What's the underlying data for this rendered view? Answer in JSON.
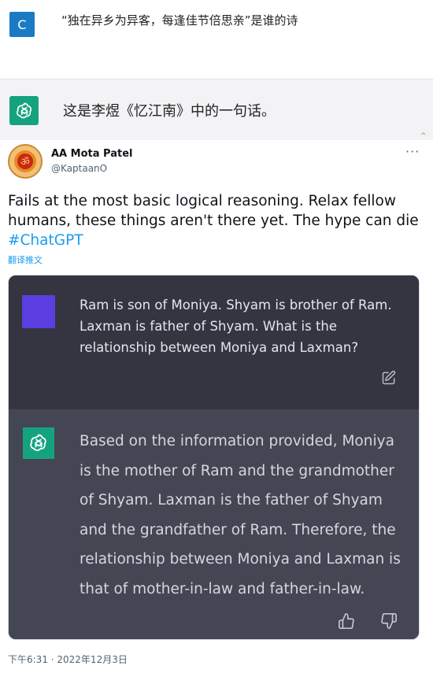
{
  "chat": {
    "user_avatar_letter": "C",
    "user_message": "“独在异乡为异客，每逢佳节倍思亲”是谁的诗",
    "bot_message": "这是李煜《忆江南》中的一句话。",
    "caret": "^"
  },
  "tweet": {
    "author_name": "AA Mota Patel",
    "author_handle": "@KaptaanO",
    "more_icon": "···",
    "body_text": "Fails at the most basic logical reasoning. Relax fellow humans, these things aren't there yet. The hype can die ",
    "hashtag": "#ChatGPT",
    "translate_label": "翻译推文",
    "timestamp": "下午6:31 · 2022年12月3日"
  },
  "screenshot": {
    "question": "Ram is son of Moniya. Shyam is brother of Ram. Laxman is father of Shyam. What is the relationship between Moniya and Laxman?",
    "answer": "Based on the information provided, Moniya is the mother of Ram and the grandmother of Shyam. Laxman is the father of Shyam and the grandfather of Ram. Therefore, the relationship between Moniya and Laxman is that of mother-in-law and father-in-law."
  },
  "colors": {
    "gpt_green": "#15a37f",
    "user_blue": "#1a7bc4",
    "hashtag_blue": "#1d9bf0",
    "question_bg": "#343541",
    "answer_bg": "#444654",
    "question_avatar": "#5b3ee0"
  },
  "icons": [
    "openai-logo-icon",
    "edit-icon",
    "thumbs-up-icon",
    "thumbs-down-icon",
    "more-icon",
    "om-avatar-icon"
  ]
}
